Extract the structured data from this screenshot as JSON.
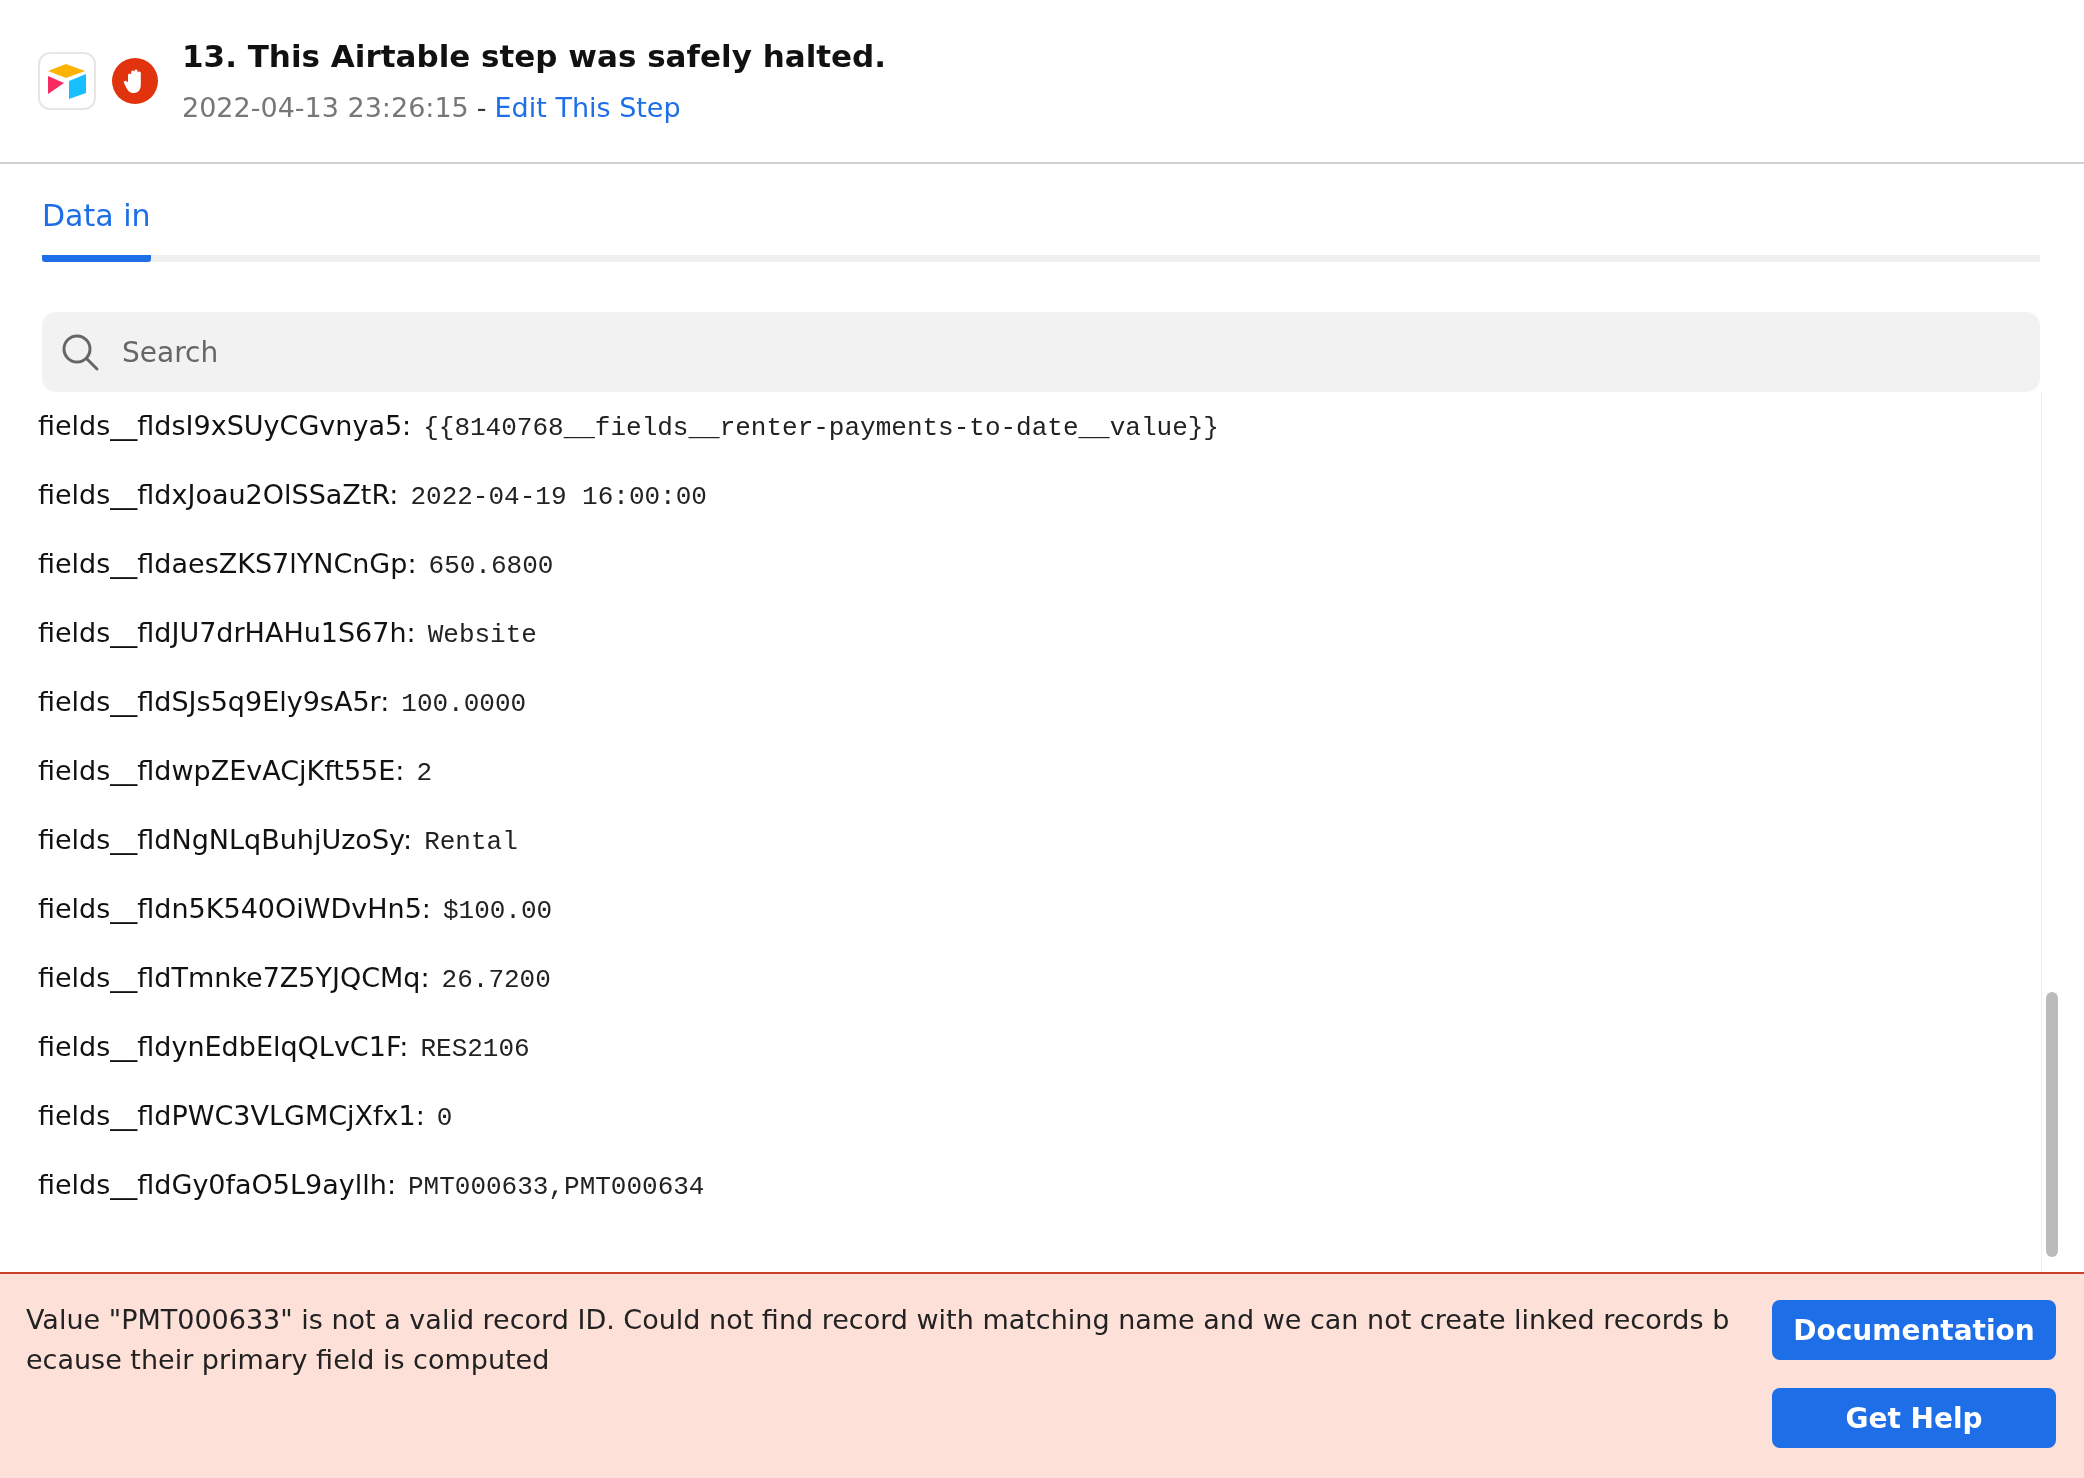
{
  "header": {
    "title": "13. This Airtable step was safely halted.",
    "timestamp": "2022-04-13 23:26:15",
    "separator": "-",
    "edit_link": "Edit This Step"
  },
  "tabs": [
    {
      "label": "Data in",
      "selected": true
    }
  ],
  "search": {
    "placeholder": "Search"
  },
  "fields": [
    {
      "name": "fields__fldsI9xSUyCGvnya5:",
      "value": "{{8140768__fields__renter-payments-to-date__value}}"
    },
    {
      "name": "fields__fldxJoau2OlSSaZtR:",
      "value": "2022-04-19 16:00:00"
    },
    {
      "name": "fields__fldaesZKS7lYNCnGp:",
      "value": "650.6800"
    },
    {
      "name": "fields__fldJU7drHAHu1S67h:",
      "value": "Website"
    },
    {
      "name": "fields__fldSJs5q9Ely9sA5r:",
      "value": "100.0000"
    },
    {
      "name": "fields__fldwpZEvACjKft55E:",
      "value": "2"
    },
    {
      "name": "fields__fldNgNLqBuhjUzoSy:",
      "value": "Rental"
    },
    {
      "name": "fields__fldn5K540OiWDvHn5:",
      "value": "$100.00"
    },
    {
      "name": "fields__fldTmnke7Z5YJQCMq:",
      "value": "26.7200"
    },
    {
      "name": "fields__fldynEdbElqQLvC1F:",
      "value": "RES2106"
    },
    {
      "name": "fields__fldPWC3VLGMCjXfx1:",
      "value": "0"
    },
    {
      "name": "fields__fldGy0faO5L9ayllh:",
      "value": "PMT000633,PMT000634"
    }
  ],
  "error": {
    "message": "Value \"PMT000633\" is not a valid record ID. Could not find record with matching name and we can not create linked records because their primary field is computed",
    "buttons": [
      "Documentation",
      "Get Help"
    ]
  }
}
